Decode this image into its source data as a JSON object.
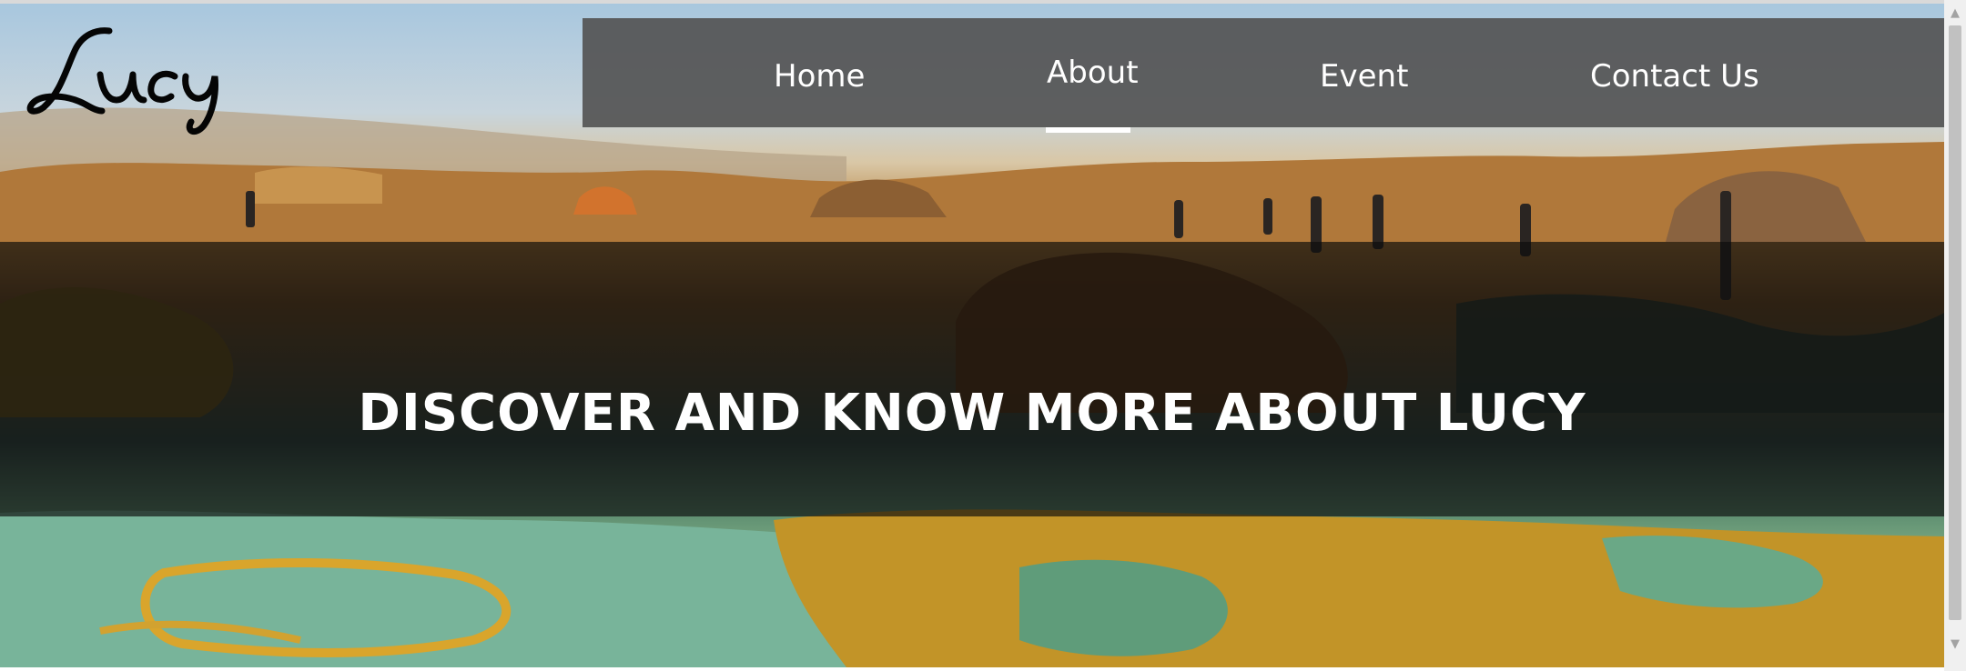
{
  "logo": {
    "text": "Lucy"
  },
  "nav": {
    "items": [
      {
        "label": "Home"
      },
      {
        "label": "About"
      },
      {
        "label": "Event"
      },
      {
        "label": "Contact Us"
      }
    ],
    "active_item": "About"
  },
  "hero": {
    "headline": "DISCOVER AND KNOW MORE ABOUT LUCY",
    "image_subject": "Dallol hot springs landscape"
  },
  "colors": {
    "nav_background": "#545454",
    "nav_text": "#ffffff",
    "overlay": "#0c0c0c",
    "headline": "#ffffff"
  },
  "scrollbar": {
    "up_icon": "arrow-up-icon",
    "down_icon": "arrow-down-icon"
  }
}
